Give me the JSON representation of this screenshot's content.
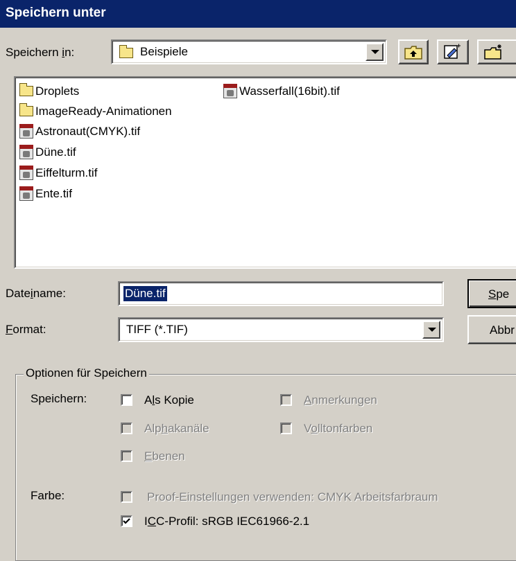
{
  "window": {
    "title": "Speichern unter"
  },
  "location": {
    "label_pre": "Speichern ",
    "label_u": "i",
    "label_post": "n:",
    "current_folder": "Beispiele"
  },
  "toolbar": {
    "up_icon": "folder-up-icon",
    "new_folder_icon": "new-folder-icon",
    "view_icon": "details-view-icon"
  },
  "files": {
    "folders": [
      "Droplets",
      "ImageReady-Animationen"
    ],
    "column1_files": [
      "Astronaut(CMYK).tif",
      "Düne.tif",
      "Eiffelturm.tif",
      "Ente.tif"
    ],
    "column2_files": [
      "Wasserfall(16bit).tif"
    ]
  },
  "filename": {
    "label_pre": "Date",
    "label_u": "i",
    "label_post": "name:",
    "value": "Düne.tif"
  },
  "format": {
    "label_u": "F",
    "label_post": "ormat:",
    "value": "TIFF (*.TIF)"
  },
  "buttons": {
    "save_u": "S",
    "save_rest": "pe",
    "cancel": "Abbr"
  },
  "options": {
    "legend": "Optionen für Speichern",
    "save_label": "Speichern:",
    "color_label": "Farbe:",
    "as_copy": {
      "pre": "A",
      "u": "l",
      "post": "s Kopie",
      "checked": false,
      "enabled": true
    },
    "alpha": {
      "pre": "Alp",
      "u": "h",
      "post": "akanäle",
      "checked": false,
      "enabled": false
    },
    "layers": {
      "pre": "",
      "u": "E",
      "post": "benen",
      "checked": false,
      "enabled": false
    },
    "annotations": {
      "pre": "",
      "u": "A",
      "post": "nmerkungen",
      "checked": false,
      "enabled": false
    },
    "spot": {
      "pre": "V",
      "u": "o",
      "post": "lltonfarben",
      "checked": false,
      "enabled": false
    },
    "proof": {
      "text": "Proof-Einstellungen verwenden: CMYK Arbeitsfarbraum",
      "checked": false,
      "enabled": false
    },
    "icc": {
      "pre": "I",
      "u": "C",
      "post": "C-Profil: sRGB IEC61966-2.1",
      "checked": true,
      "enabled": true
    }
  }
}
